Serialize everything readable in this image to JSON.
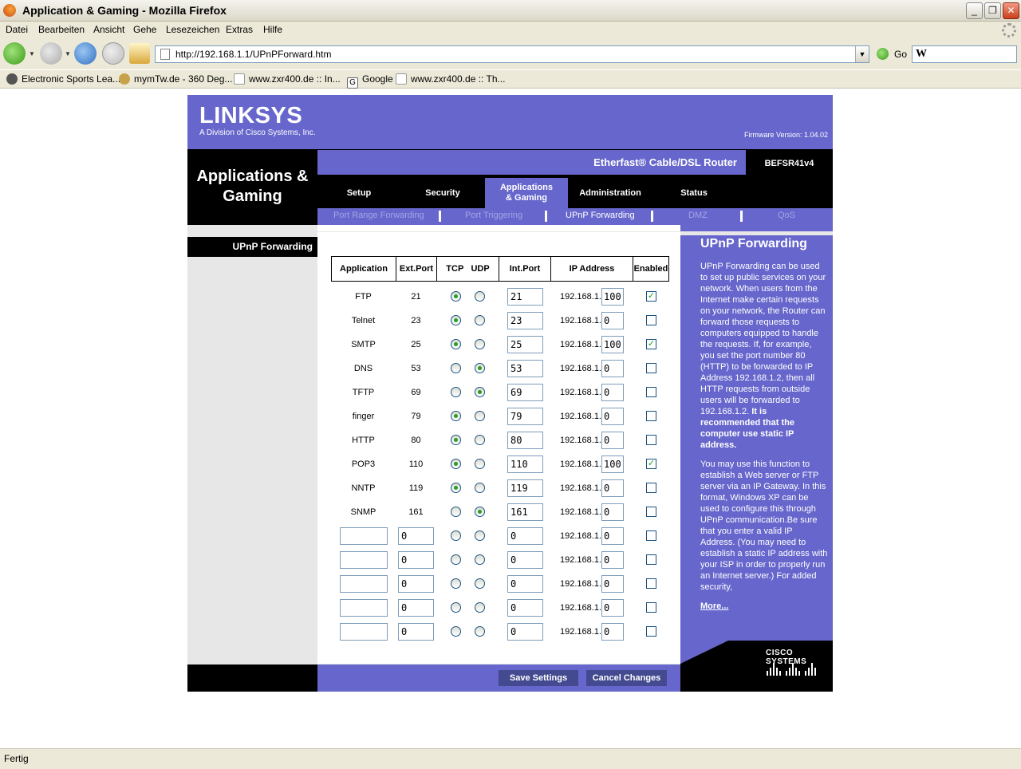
{
  "window": {
    "title": "Application & Gaming - Mozilla Firefox"
  },
  "menu": [
    "Datei",
    "Bearbeiten",
    "Ansicht",
    "Gehe",
    "Lesezeichen",
    "Extras",
    "Hilfe"
  ],
  "nav": {
    "url": "http://192.168.1.1/UPnPForward.htm",
    "go": "Go",
    "search_logo": "W"
  },
  "bookmarks": [
    "Electronic Sports Lea...",
    "mymTw.de - 360 Deg...",
    "www.zxr400.de :: In...",
    "Google",
    "www.zxr400.de :: Th..."
  ],
  "status": "Fertig",
  "linksys": {
    "logo": "LINKSYS",
    "logo_sub": "A Division of Cisco Systems, Inc.",
    "firmware": "Firmware Version: 1.04.02",
    "section": "Applications & Gaming",
    "product": "Etherfast® Cable/DSL Router",
    "model": "BEFSR41v4",
    "tabs": [
      "Setup",
      "Security",
      "Applications & Gaming",
      "Administration",
      "Status"
    ],
    "subtabs": [
      "Port Range Forwarding",
      "Port Triggering",
      "UPnP Forwarding",
      "DMZ",
      "QoS"
    ],
    "left_label": "UPnP Forwarding",
    "table_headers": [
      "Application",
      "Ext.Port",
      "TCP",
      "UDP",
      "Int.Port",
      "IP Address",
      "Enabled"
    ],
    "ip_prefix": "192.168.1.",
    "rows": [
      {
        "app": "FTP",
        "ext": "21",
        "proto": "tcp",
        "int": "21",
        "ip": "100",
        "enabled": true
      },
      {
        "app": "Telnet",
        "ext": "23",
        "proto": "tcp",
        "int": "23",
        "ip": "0",
        "enabled": false
      },
      {
        "app": "SMTP",
        "ext": "25",
        "proto": "tcp",
        "int": "25",
        "ip": "100",
        "enabled": true
      },
      {
        "app": "DNS",
        "ext": "53",
        "proto": "udp",
        "int": "53",
        "ip": "0",
        "enabled": false
      },
      {
        "app": "TFTP",
        "ext": "69",
        "proto": "udp",
        "int": "69",
        "ip": "0",
        "enabled": false
      },
      {
        "app": "finger",
        "ext": "79",
        "proto": "tcp",
        "int": "79",
        "ip": "0",
        "enabled": false
      },
      {
        "app": "HTTP",
        "ext": "80",
        "proto": "tcp",
        "int": "80",
        "ip": "0",
        "enabled": false
      },
      {
        "app": "POP3",
        "ext": "110",
        "proto": "tcp",
        "int": "110",
        "ip": "100",
        "enabled": true
      },
      {
        "app": "NNTP",
        "ext": "119",
        "proto": "tcp",
        "int": "119",
        "ip": "0",
        "enabled": false
      },
      {
        "app": "SNMP",
        "ext": "161",
        "proto": "udp",
        "int": "161",
        "ip": "0",
        "enabled": false
      },
      {
        "app": "",
        "ext": "0",
        "proto": "none",
        "int": "0",
        "ip": "0",
        "enabled": false
      },
      {
        "app": "",
        "ext": "0",
        "proto": "none",
        "int": "0",
        "ip": "0",
        "enabled": false
      },
      {
        "app": "",
        "ext": "0",
        "proto": "none",
        "int": "0",
        "ip": "0",
        "enabled": false
      },
      {
        "app": "",
        "ext": "0",
        "proto": "none",
        "int": "0",
        "ip": "0",
        "enabled": false
      },
      {
        "app": "",
        "ext": "0",
        "proto": "none",
        "int": "0",
        "ip": "0",
        "enabled": false
      }
    ],
    "help_title": "UPnP Forwarding",
    "help_p1": "UPnP Forwarding can be used to set up public services on your network. When users from the Internet make certain requests on your network, the Router can forward those requests to computers equipped to handle the requests. If, for example, you set the port number 80 (HTTP) to be forwarded to IP Address 192.168.1.2, then all HTTP requests from outside users will be forwarded to 192.168.1.2.",
    "help_p1_bold": "It is recommended that the computer use static IP address.",
    "help_p2": "You may use this function to establish a Web server or FTP server via an IP Gateway. In this format, Windows XP can be used to configure this through UPnP communication.Be sure that you enter a valid IP Address. (You may need to establish a static IP address with your ISP in order to properly run an Internet server.) For added security,",
    "more": "More...",
    "cisco": "CISCO SYSTEMS",
    "save": "Save Settings",
    "cancel": "Cancel Changes"
  }
}
